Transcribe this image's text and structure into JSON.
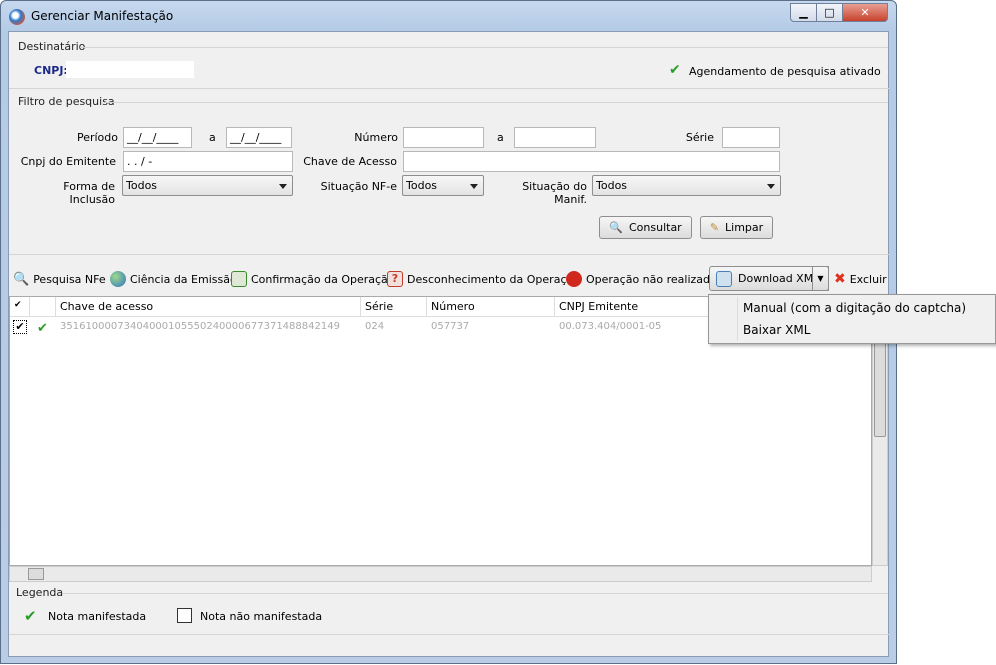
{
  "window": {
    "title": "Gerenciar Manifestação",
    "minimize": "▁",
    "maximize": "□",
    "close": "✕"
  },
  "destinatario": {
    "label": "Destinatário",
    "cnpj_label": "CNPJ:",
    "cnpj_value": "",
    "agendamento": "Agendamento de pesquisa ativado"
  },
  "filtro": {
    "label": "Filtro de pesquisa",
    "periodo": "Período",
    "periodo_de": "__/__/____",
    "a1": "a",
    "periodo_ate": "__/__/____",
    "numero": "Número",
    "numero_de": "",
    "a2": "a",
    "numero_ate": "",
    "serie": "Série",
    "serie_value": "",
    "cnpj_emitente": "Cnpj do Emitente",
    "cnpj_emitente_value": " .  .  /  -",
    "chave": "Chave de Acesso",
    "chave_value": "",
    "forma": "Forma de Inclusão",
    "forma_value": "Todos",
    "situacao_nfe": "Situação NF-e",
    "situacao_nfe_value": "Todos",
    "situacao_manif": "Situação do Manif.",
    "situacao_manif_value": "Todos",
    "consultar": "Consultar",
    "limpar": "Limpar"
  },
  "toolbar": {
    "pesquisa": "Pesquisa NFe",
    "ciencia": "Ciência da Emissão",
    "confirmacao": "Confirmação da Operação",
    "desconhecimento": "Desconhecimento da Operação",
    "nao_realizada": "Operação não realizada",
    "download": "Download XML",
    "excluir": "Excluir"
  },
  "menu": {
    "items": [
      "Manual (com a digitação do captcha)",
      "Baixar XML"
    ]
  },
  "grid": {
    "headers": {
      "check": "✔",
      "chave": "Chave de acesso",
      "serie": "Série",
      "numero": "Número",
      "cnpj": "CNPJ Emitente"
    },
    "rows": [
      {
        "chave": "35161000073404000105550240000677371488842149",
        "serie": "024",
        "numero": "057737",
        "cnpj": "00.073.404/0001-05"
      }
    ]
  },
  "legenda": {
    "label": "Legenda",
    "manifestada": "Nota manifestada",
    "nao_manifestada": "Nota não manifestada"
  },
  "colors": {
    "check_green": "#2a9d2a",
    "cnpj_label": "#1c2a8c"
  }
}
